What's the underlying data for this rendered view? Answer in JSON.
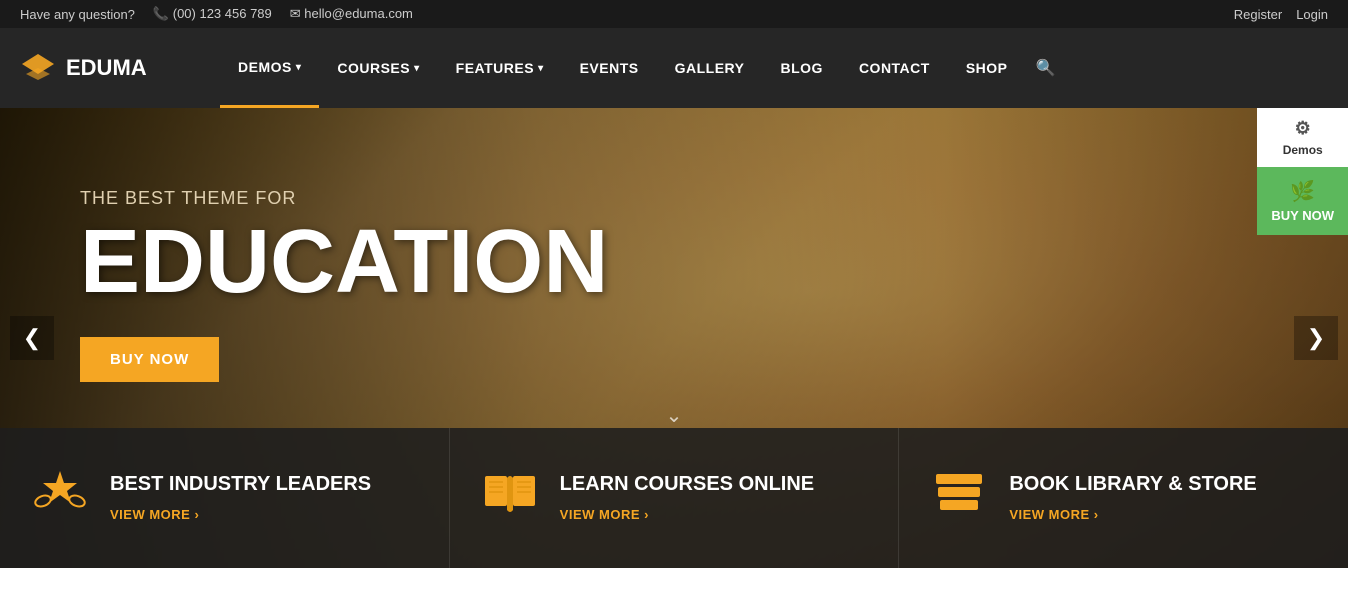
{
  "topbar": {
    "question_label": "Have any question?",
    "phone": "(00) 123 456 789",
    "email": "hello@eduma.com",
    "register": "Register",
    "login": "Login"
  },
  "header": {
    "logo_text": "EDUMA",
    "nav": [
      {
        "label": "DEMOS",
        "has_dropdown": true,
        "active": true
      },
      {
        "label": "COURSES",
        "has_dropdown": true,
        "active": false
      },
      {
        "label": "FEATURES",
        "has_dropdown": true,
        "active": false
      },
      {
        "label": "EVENTS",
        "has_dropdown": false,
        "active": false
      },
      {
        "label": "GALLERY",
        "has_dropdown": false,
        "active": false
      },
      {
        "label": "BLOG",
        "has_dropdown": false,
        "active": false
      },
      {
        "label": "CONTACT",
        "has_dropdown": false,
        "active": false
      },
      {
        "label": "SHOP",
        "has_dropdown": false,
        "active": false
      }
    ]
  },
  "hero": {
    "subtitle": "THE BEST THEME FOR",
    "title": "EDUCATION",
    "buy_button": "BUY NOW",
    "scroll_indicator": "❯"
  },
  "features": [
    {
      "icon": "★",
      "title": "BEST INDUSTRY LEADERS",
      "link": "VIEW MORE ›"
    },
    {
      "icon": "📖",
      "title": "LEARN COURSES ONLINE",
      "link": "VIEW MORE ›"
    },
    {
      "icon": "📚",
      "title": "BOOK LIBRARY & STORE",
      "link": "VIEW MORE ›"
    }
  ],
  "right_panels": {
    "demos_label": "Demos",
    "buy_now_label": "Buy Now"
  },
  "colors": {
    "accent": "#f5a623",
    "dark_bg": "#1a1a1a",
    "green": "#5cb85c"
  }
}
